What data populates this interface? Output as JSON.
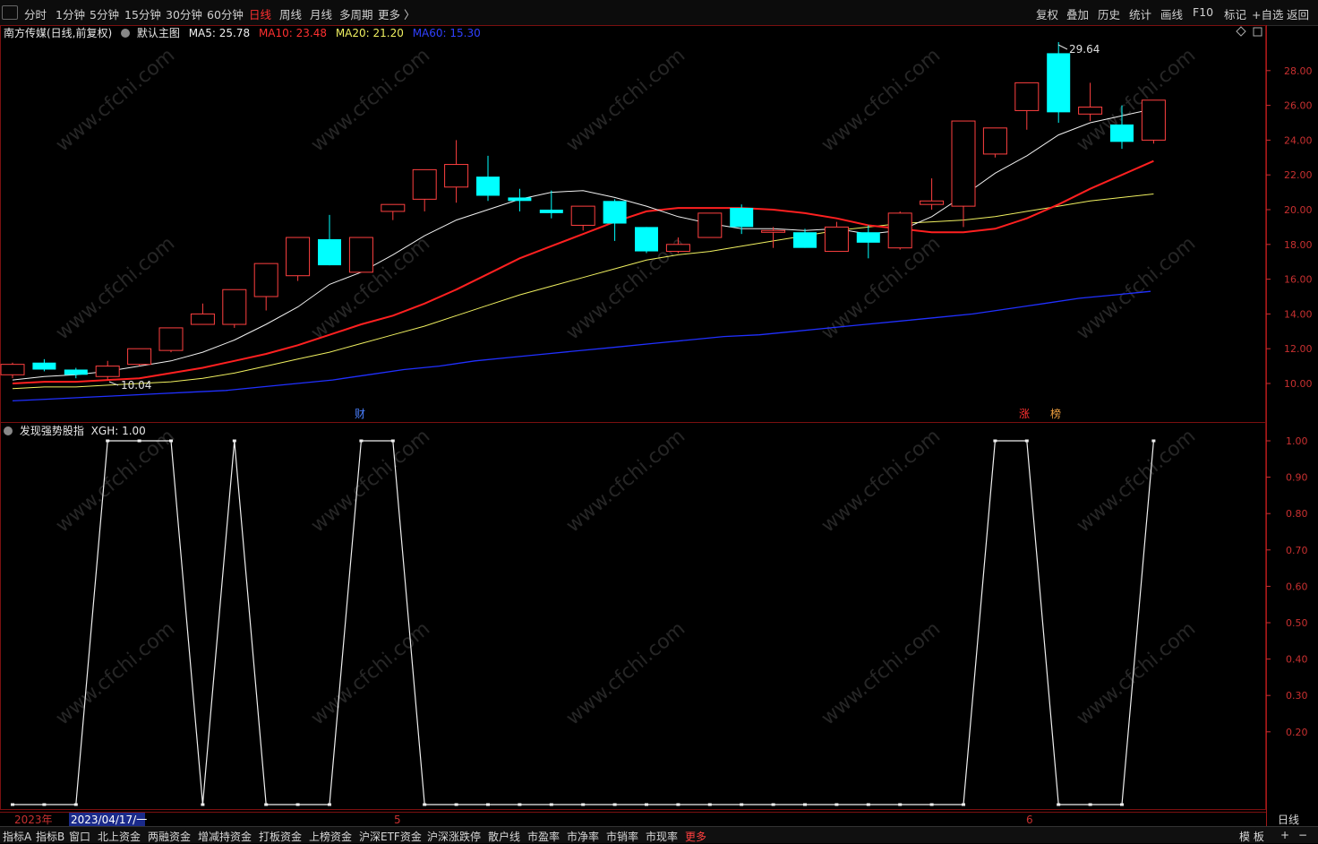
{
  "toolbar": {
    "periods": [
      "分时",
      "1分钟",
      "5分钟",
      "15分钟",
      "30分钟",
      "60分钟",
      "日线",
      "周线",
      "月线",
      "多周期",
      "更多 〉"
    ],
    "active_period": "日线",
    "right_buttons": [
      "复权",
      "叠加",
      "历史",
      "统计",
      "画线",
      "F10",
      "标记",
      "+自选",
      "返回"
    ]
  },
  "main_legend": {
    "stock_name": "南方传媒(日线,前复权)",
    "template": "默认主图",
    "ma5": "MA5: 25.78",
    "ma10": "MA10: 23.48",
    "ma20": "MA20: 21.20",
    "ma60": "MA60: 15.30",
    "high_label": "29.64",
    "low_label": "10.04",
    "colors": {
      "ma5": "#f0f0f0",
      "ma10": "#ff2020",
      "ma20": "#f0f060",
      "ma60": "#2030ff",
      "up": "#ff4040",
      "down": "#00ffff"
    }
  },
  "price_axis": [
    "28.00",
    "26.00",
    "24.00",
    "22.00",
    "20.00",
    "18.00",
    "16.00",
    "14.00",
    "12.00",
    "10.00"
  ],
  "markers": {
    "cai": "财",
    "zhang": "涨",
    "bang": "榜"
  },
  "indicator": {
    "title": "发现强势股指",
    "value_label": "XGH: 1.00",
    "axis": [
      "1.00",
      "0.90",
      "0.80",
      "0.70",
      "0.60",
      "0.50",
      "0.40",
      "0.30",
      "0.20"
    ]
  },
  "time_axis": {
    "year": "2023年",
    "cursor_date": "2023/04/17/一",
    "month5": "5",
    "month6": "6",
    "period_label": "日线"
  },
  "bottom_tabs": [
    "指标A",
    "指标B",
    "窗口",
    "北上资金",
    "两融资金",
    "增减持资金",
    "打板资金",
    "上榜资金",
    "沪深ETF资金",
    "沪深涨跌停",
    "散户线",
    "市盈率",
    "市净率",
    "市销率",
    "市现率",
    "更多"
  ],
  "bottom_right": [
    "模 板",
    "+",
    "−"
  ],
  "watermark": "www.cfchi.com",
  "chart_data": {
    "type": "candlestick",
    "candles": [
      {
        "o": 10.5,
        "c": 11.1,
        "h": 11.2,
        "l": 10.3
      },
      {
        "o": 11.2,
        "c": 10.8,
        "h": 11.4,
        "l": 10.7
      },
      {
        "o": 10.8,
        "c": 10.5,
        "h": 10.9,
        "l": 10.3
      },
      {
        "o": 10.4,
        "c": 11.0,
        "h": 11.3,
        "l": 10.2
      },
      {
        "o": 11.1,
        "c": 12.0,
        "h": 12.0,
        "l": 11.0
      },
      {
        "o": 11.9,
        "c": 13.2,
        "h": 13.2,
        "l": 11.8
      },
      {
        "o": 13.4,
        "c": 14.0,
        "h": 14.6,
        "l": 13.4
      },
      {
        "o": 13.4,
        "c": 15.4,
        "h": 15.4,
        "l": 13.2
      },
      {
        "o": 15.0,
        "c": 16.9,
        "h": 16.9,
        "l": 14.2
      },
      {
        "o": 16.2,
        "c": 18.4,
        "h": 18.4,
        "l": 15.9
      },
      {
        "o": 18.3,
        "c": 16.8,
        "h": 19.7,
        "l": 16.8
      },
      {
        "o": 16.4,
        "c": 18.4,
        "h": 18.4,
        "l": 16.4
      },
      {
        "o": 19.9,
        "c": 20.3,
        "h": 20.3,
        "l": 19.4
      },
      {
        "o": 20.6,
        "c": 22.3,
        "h": 22.3,
        "l": 19.9
      },
      {
        "o": 21.3,
        "c": 22.6,
        "h": 24.0,
        "l": 20.4
      },
      {
        "o": 21.9,
        "c": 20.8,
        "h": 23.1,
        "l": 20.5
      },
      {
        "o": 20.7,
        "c": 20.5,
        "h": 21.2,
        "l": 19.9
      },
      {
        "o": 20.0,
        "c": 19.8,
        "h": 21.1,
        "l": 19.5
      },
      {
        "o": 19.1,
        "c": 20.2,
        "h": 20.2,
        "l": 18.8
      },
      {
        "o": 20.5,
        "c": 19.2,
        "h": 20.6,
        "l": 18.2
      },
      {
        "o": 19.0,
        "c": 17.6,
        "h": 19.0,
        "l": 17.5
      },
      {
        "o": 17.6,
        "c": 18.0,
        "h": 18.4,
        "l": 17.5
      },
      {
        "o": 18.4,
        "c": 19.8,
        "h": 19.8,
        "l": 18.4
      },
      {
        "o": 20.1,
        "c": 19.0,
        "h": 20.3,
        "l": 18.6
      },
      {
        "o": 18.8,
        "c": 18.8,
        "h": 19.0,
        "l": 17.8
      },
      {
        "o": 18.7,
        "c": 17.8,
        "h": 18.9,
        "l": 17.8
      },
      {
        "o": 17.6,
        "c": 19.0,
        "h": 19.3,
        "l": 17.6
      },
      {
        "o": 18.7,
        "c": 18.1,
        "h": 19.1,
        "l": 17.2
      },
      {
        "o": 17.8,
        "c": 19.8,
        "h": 19.9,
        "l": 17.7
      },
      {
        "o": 20.3,
        "c": 20.5,
        "h": 21.8,
        "l": 20.0
      },
      {
        "o": 20.2,
        "c": 25.1,
        "h": 25.1,
        "l": 19.0
      },
      {
        "o": 23.2,
        "c": 24.7,
        "h": 24.7,
        "l": 23.0
      },
      {
        "o": 25.7,
        "c": 27.3,
        "h": 27.3,
        "l": 24.6
      },
      {
        "o": 29.0,
        "c": 25.6,
        "h": 29.64,
        "l": 25.0
      },
      {
        "o": 25.5,
        "c": 25.9,
        "h": 27.3,
        "l": 25.1
      },
      {
        "o": 24.9,
        "c": 23.9,
        "h": 26.0,
        "l": 23.5
      },
      {
        "o": 24.0,
        "c": 26.3,
        "h": 26.3,
        "l": 23.8
      }
    ],
    "ma5": [
      10.2,
      10.4,
      10.5,
      10.7,
      11.0,
      11.3,
      11.8,
      12.5,
      13.4,
      14.4,
      15.7,
      16.4,
      17.4,
      18.5,
      19.4,
      20.0,
      20.6,
      21.0,
      21.1,
      20.7,
      20.2,
      19.6,
      19.2,
      18.9,
      18.9,
      18.8,
      18.9,
      18.6,
      18.8,
      19.6,
      20.8,
      22.1,
      23.1,
      24.3,
      25.0,
      25.4,
      25.8
    ],
    "ma10": [
      10.0,
      10.1,
      10.1,
      10.2,
      10.3,
      10.6,
      10.9,
      11.3,
      11.7,
      12.2,
      12.8,
      13.4,
      13.9,
      14.6,
      15.4,
      16.3,
      17.2,
      17.9,
      18.6,
      19.3,
      19.9,
      20.1,
      20.1,
      20.1,
      20.0,
      19.8,
      19.5,
      19.1,
      18.9,
      18.7,
      18.7,
      18.9,
      19.5,
      20.3,
      21.2,
      22.0,
      22.8,
      23.5
    ],
    "ma20": [
      9.7,
      9.8,
      9.8,
      9.9,
      10.0,
      10.1,
      10.3,
      10.6,
      11.0,
      11.4,
      11.8,
      12.3,
      12.8,
      13.3,
      13.9,
      14.5,
      15.1,
      15.6,
      16.1,
      16.6,
      17.1,
      17.4,
      17.6,
      17.9,
      18.2,
      18.5,
      18.8,
      19.0,
      19.2,
      19.3,
      19.4,
      19.6,
      19.9,
      20.2,
      20.5,
      20.7,
      20.9,
      21.2
    ],
    "ma60": [
      9.0,
      9.1,
      9.2,
      9.3,
      9.4,
      9.5,
      9.6,
      9.8,
      10.0,
      10.2,
      10.5,
      10.8,
      11.0,
      11.3,
      11.5,
      11.7,
      11.9,
      12.1,
      12.3,
      12.5,
      12.7,
      12.8,
      13.0,
      13.2,
      13.4,
      13.6,
      13.8,
      14.0,
      14.3,
      14.6,
      14.9,
      15.1,
      15.3
    ],
    "xgh": [
      0,
      0,
      0,
      1,
      1,
      1,
      0,
      1,
      0,
      0,
      0,
      1,
      1,
      0,
      0,
      0,
      0,
      0,
      0,
      0,
      0,
      0,
      0,
      0,
      0,
      0,
      0,
      0,
      0,
      0,
      0,
      1,
      1,
      0,
      0,
      0,
      1
    ]
  }
}
